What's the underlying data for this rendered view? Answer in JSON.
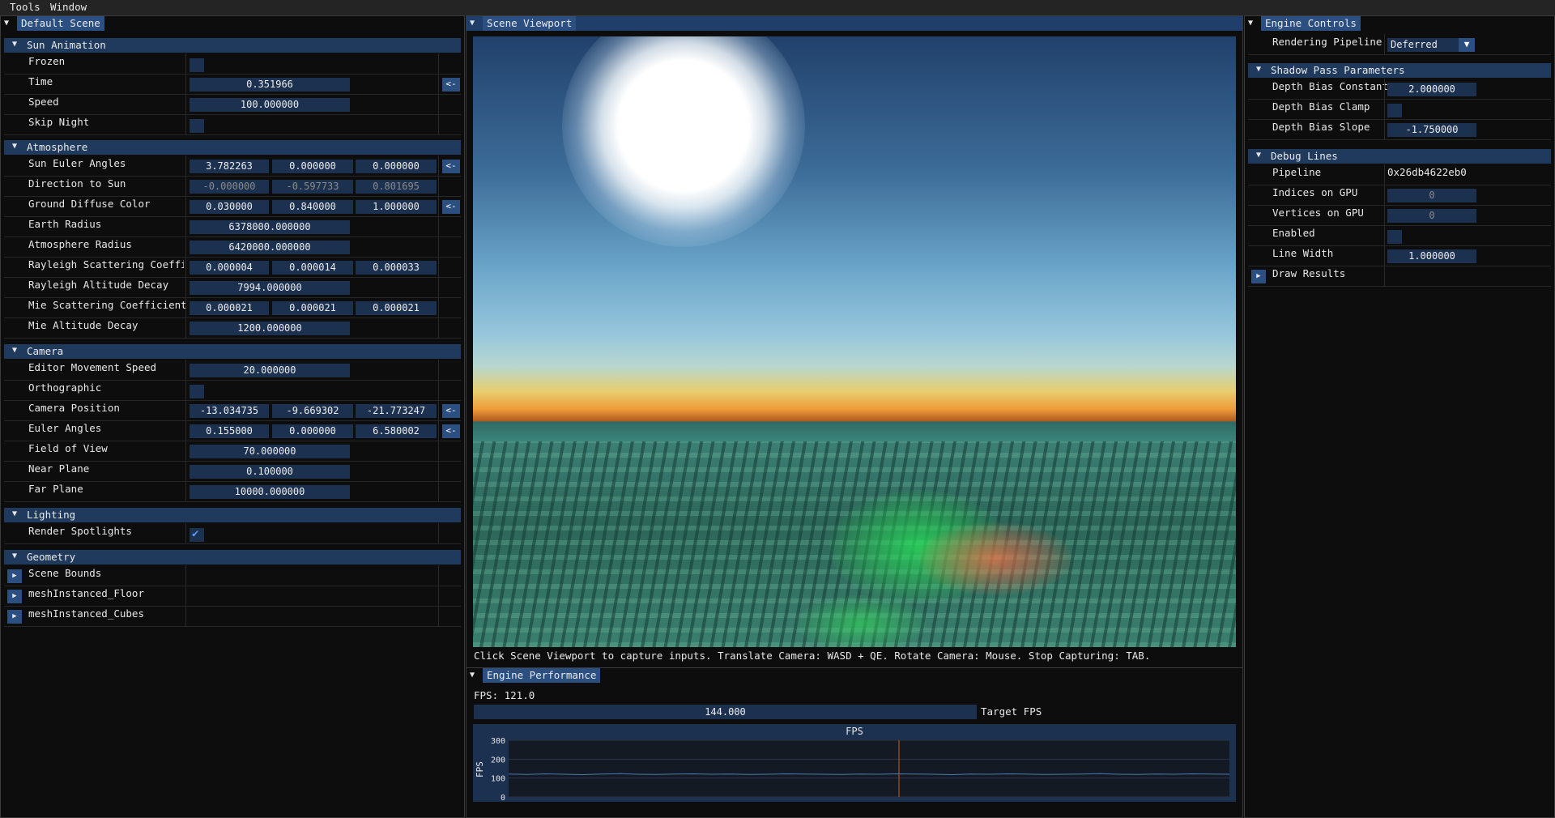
{
  "menu": [
    "Tools",
    "Window"
  ],
  "left": {
    "tab": "Default Scene",
    "sections": {
      "sun": "Sun Animation",
      "atmosphere": "Atmosphere",
      "camera": "Camera",
      "lighting": "Lighting",
      "geometry": "Geometry"
    },
    "rows": {
      "frozen": "Frozen",
      "time": "Time",
      "time_val": "0.351966",
      "speed": "Speed",
      "speed_val": "100.000000",
      "skip_night": "Skip Night",
      "sun_euler": "Sun Euler Angles",
      "sun_euler_vals": [
        "3.782263",
        "0.000000",
        "0.000000"
      ],
      "dir_sun": "Direction to Sun",
      "dir_sun_vals": [
        "-0.000000",
        "-0.597733",
        "0.801695"
      ],
      "ground_color": "Ground Diffuse Color",
      "ground_color_vals": [
        "0.030000",
        "0.840000",
        "1.000000"
      ],
      "earth_radius": "Earth Radius",
      "earth_radius_val": "6378000.000000",
      "atmo_radius": "Atmosphere Radius",
      "atmo_radius_val": "6420000.000000",
      "rayleigh_scat": "Rayleigh Scattering Coeffici",
      "rayleigh_scat_vals": [
        "0.000004",
        "0.000014",
        "0.000033"
      ],
      "rayleigh_decay": "Rayleigh Altitude Decay",
      "rayleigh_decay_val": "7994.000000",
      "mie_scat": "Mie Scattering Coefficient",
      "mie_scat_vals": [
        "0.000021",
        "0.000021",
        "0.000021"
      ],
      "mie_decay": "Mie Altitude Decay",
      "mie_decay_val": "1200.000000",
      "editor_speed": "Editor Movement Speed",
      "editor_speed_val": "20.000000",
      "ortho": "Orthographic",
      "cam_pos": "Camera Position",
      "cam_pos_vals": [
        "-13.034735",
        "-9.669302",
        "-21.773247"
      ],
      "euler": "Euler Angles",
      "euler_vals": [
        "0.155000",
        "0.000000",
        "6.580002"
      ],
      "fov": "Field of View",
      "fov_val": "70.000000",
      "near": "Near Plane",
      "near_val": "0.100000",
      "far": "Far Plane",
      "far_val": "10000.000000",
      "render_spot": "Render Spotlights",
      "scene_bounds": "Scene Bounds",
      "mesh_floor": "meshInstanced_Floor",
      "mesh_cubes": "meshInstanced_Cubes"
    },
    "reset_btn": "<-"
  },
  "viewport": {
    "tab": "Scene Viewport",
    "hint": "Click Scene Viewport to capture inputs. Translate Camera: WASD + QE. Rotate Camera: Mouse. Stop Capturing: TAB."
  },
  "perf": {
    "tab": "Engine Performance",
    "fps": "FPS: 121.0",
    "target_val": "144.000",
    "target_lbl": "Target FPS",
    "plot_title": "FPS",
    "plot_ylabel": "FPS",
    "plot_ticks": [
      "300",
      "200",
      "100",
      "0"
    ]
  },
  "right": {
    "tab": "Engine Controls",
    "pipeline_lbl": "Rendering Pipeline",
    "pipeline_val": "Deferred",
    "shadow": "Shadow Pass Parameters",
    "db_const": "Depth Bias Constant",
    "db_const_val": "2.000000",
    "db_clamp": "Depth Bias Clamp",
    "db_slope": "Depth Bias Slope",
    "db_slope_val": "-1.750000",
    "debug": "Debug Lines",
    "pipeline2": "Pipeline",
    "pipeline2_val": "0x26db4622eb0",
    "indices": "Indices on GPU",
    "indices_val": "0",
    "vertices": "Vertices on GPU",
    "vertices_val": "0",
    "enabled": "Enabled",
    "line_width": "Line Width",
    "line_width_val": "1.000000",
    "draw_results": "Draw Results"
  },
  "chart_data": {
    "type": "line",
    "title": "FPS",
    "ylabel": "FPS",
    "ylim": [
      0,
      300
    ],
    "y_ticks": [
      300,
      200,
      100,
      0
    ],
    "series": [
      {
        "values": [
          121,
          119,
          122,
          120,
          118,
          121,
          123,
          120,
          119,
          121,
          122,
          120,
          121,
          119,
          120,
          122,
          121,
          120,
          119,
          121,
          120,
          122,
          121,
          120,
          118,
          121,
          120,
          122,
          121,
          119,
          120,
          121,
          123,
          120,
          119,
          121,
          120,
          122,
          121,
          120
        ]
      }
    ]
  }
}
